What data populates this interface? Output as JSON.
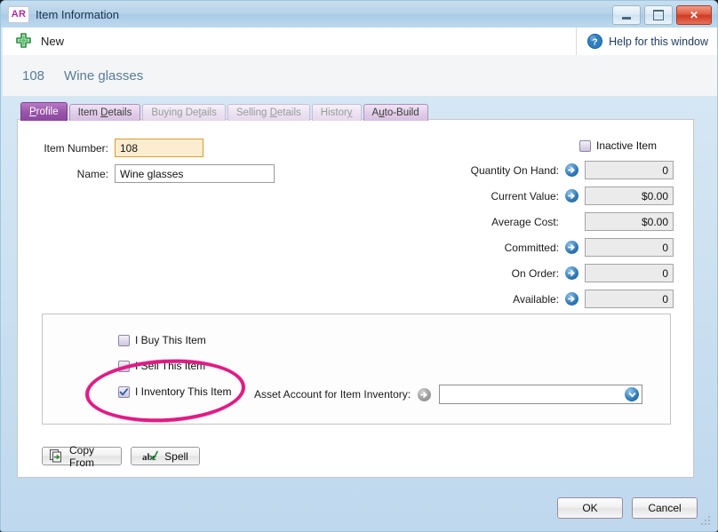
{
  "window": {
    "app_badge": "AR",
    "title": "Item Information",
    "minimize_icon": "minimize-icon",
    "maximize_icon": "maximize-icon",
    "close_label": "✕"
  },
  "toolbar": {
    "new_label": "New",
    "new_icon": "green-plus-icon",
    "help_label": "Help for this window",
    "help_icon": "help-question-icon"
  },
  "header": {
    "item_number": "108",
    "item_name": "Wine glasses"
  },
  "tabs": [
    {
      "label": "Profile",
      "accel": "P",
      "state": "active"
    },
    {
      "label": "Item Details",
      "accel": "D",
      "state": "normal"
    },
    {
      "label": "Buying Details",
      "accel": "t",
      "state": "disabled"
    },
    {
      "label": "Selling Details",
      "accel": "D",
      "state": "disabled"
    },
    {
      "label": "History",
      "accel": "y",
      "state": "disabled"
    },
    {
      "label": "Auto-Build",
      "accel": "u",
      "state": "normal"
    }
  ],
  "left_fields": {
    "item_number_label": "Item Number:",
    "item_number_value": "108",
    "name_label": "Name:",
    "name_value": "Wine glasses"
  },
  "inactive": {
    "label": "Inactive Item",
    "checked": false
  },
  "right_fields": [
    {
      "label": "Quantity On Hand:",
      "value": "0",
      "drill": true
    },
    {
      "label": "Current Value:",
      "value": "$0.00",
      "drill": true
    },
    {
      "label": "Average Cost:",
      "value": "$0.00",
      "drill": false
    },
    {
      "label": "Committed:",
      "value": "0",
      "drill": true
    },
    {
      "label": "On Order:",
      "value": "0",
      "drill": true
    },
    {
      "label": "Available:",
      "value": "0",
      "drill": true
    }
  ],
  "checkboxes": [
    {
      "label": "I Buy This Item",
      "checked": false
    },
    {
      "label": "I Sell This Item",
      "checked": false
    },
    {
      "label": "I Inventory This Item",
      "checked": true
    }
  ],
  "asset_account": {
    "label": "Asset Account for Item Inventory:",
    "value": "",
    "dropdown_icon": "chevron-down-circle-icon"
  },
  "action_buttons": {
    "copy_from_label": "Copy From",
    "copy_from_icon": "copy-document-icon",
    "spell_label": "Spell",
    "spell_icon": "spellcheck-abc-icon"
  },
  "footer": {
    "ok_label": "OK",
    "cancel_label": "Cancel"
  },
  "annotation": {
    "shape": "ellipse-highlight",
    "color": "#e01b84",
    "targets": "I Inventory This Item"
  },
  "colors": {
    "accent_purple": "#9a55ab",
    "key_field_bg": "#fdedd0",
    "readonly_bg": "#ebebeb",
    "annotation_pink": "#e01b84",
    "title_blue": "#b4d2e9"
  }
}
